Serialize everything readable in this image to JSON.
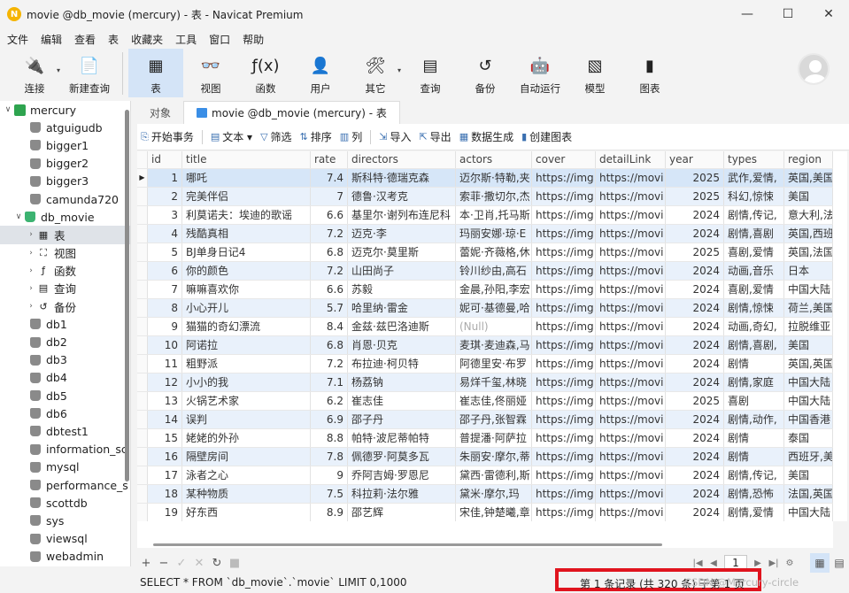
{
  "window": {
    "title": "movie @db_movie (mercury) - 表 - Navicat Premium",
    "minimize": "—",
    "maximize": "☐",
    "close": "✕"
  },
  "menu": [
    "文件",
    "编辑",
    "查看",
    "表",
    "收藏夹",
    "工具",
    "窗口",
    "帮助"
  ],
  "toolbar": [
    {
      "label": "连接",
      "icon": "plug-icon",
      "glyph": "🔌",
      "arrow": true
    },
    {
      "label": "新建查询",
      "icon": "new-query-icon",
      "glyph": "📄"
    },
    {
      "label": "表",
      "icon": "table-icon",
      "glyph": "▦",
      "active": true
    },
    {
      "label": "视图",
      "icon": "view-icon",
      "glyph": "👓"
    },
    {
      "label": "函数",
      "icon": "function-icon",
      "glyph": "ƒ(x)"
    },
    {
      "label": "用户",
      "icon": "user-icon",
      "glyph": "👤"
    },
    {
      "label": "其它",
      "icon": "tools-icon",
      "glyph": "🛠",
      "arrow": true
    },
    {
      "label": "查询",
      "icon": "query-icon",
      "glyph": "▤"
    },
    {
      "label": "备份",
      "icon": "backup-icon",
      "glyph": "↺"
    },
    {
      "label": "自动运行",
      "icon": "robot-icon",
      "glyph": "🤖"
    },
    {
      "label": "模型",
      "icon": "model-icon",
      "glyph": "▧"
    },
    {
      "label": "图表",
      "icon": "chart-icon",
      "glyph": "▮"
    }
  ],
  "tree": {
    "connection": "mercury",
    "databases_before": [
      "atguigudb",
      "bigger1",
      "bigger2",
      "bigger3",
      "camunda720"
    ],
    "open_db": "db_movie",
    "open_db_children": [
      {
        "label": "表",
        "icon": "table-icon",
        "glyph": "▦",
        "selected": true
      },
      {
        "label": "视图",
        "icon": "view-icon",
        "glyph": "⛶"
      },
      {
        "label": "函数",
        "icon": "function-icon",
        "glyph": "ƒ"
      },
      {
        "label": "查询",
        "icon": "query-icon",
        "glyph": "▤"
      },
      {
        "label": "备份",
        "icon": "backup-icon",
        "glyph": "↺"
      }
    ],
    "databases_after": [
      "db1",
      "db2",
      "db3",
      "db4",
      "db5",
      "db6",
      "dbtest1",
      "information_sc",
      "mysql",
      "performance_s",
      "scottdb",
      "sys",
      "viewsql",
      "webadmin"
    ]
  },
  "tabs": [
    {
      "label": "对象",
      "active": false
    },
    {
      "label": "movie @db_movie (mercury) - 表",
      "active": true
    }
  ],
  "actions": [
    {
      "label": "开始事务",
      "icon": "transaction-icon",
      "glyph": "⎘"
    },
    {
      "sep": true
    },
    {
      "label": "文本 ▾",
      "icon": "text-icon",
      "glyph": "▤"
    },
    {
      "label": "筛选",
      "icon": "filter-icon",
      "glyph": "▽"
    },
    {
      "label": "排序",
      "icon": "sort-icon",
      "glyph": "⇅"
    },
    {
      "label": "列",
      "icon": "columns-icon",
      "glyph": "▥"
    },
    {
      "sep": true
    },
    {
      "label": "导入",
      "icon": "import-icon",
      "glyph": "⇲"
    },
    {
      "label": "导出",
      "icon": "export-icon",
      "glyph": "⇱"
    },
    {
      "label": "数据生成",
      "icon": "datagen-icon",
      "glyph": "▦"
    },
    {
      "label": "创建图表",
      "icon": "create-chart-icon",
      "glyph": "▮"
    }
  ],
  "grid": {
    "columns": [
      {
        "name": "id",
        "w": 39
      },
      {
        "name": "title",
        "w": 145
      },
      {
        "name": "rate",
        "w": 42
      },
      {
        "name": "directors",
        "w": 122
      },
      {
        "name": "actors",
        "w": 86
      },
      {
        "name": "cover",
        "w": 72
      },
      {
        "name": "detailLink",
        "w": 79
      },
      {
        "name": "year",
        "w": 66
      },
      {
        "name": "types",
        "w": 68
      },
      {
        "name": "region",
        "w": 55
      }
    ],
    "rows": [
      [
        "1",
        "哪吒",
        "7.4",
        "斯科特·德瑞克森",
        "迈尔斯·特勒,夹",
        "https://img",
        "https://movi",
        "2025",
        "武作,爱情,",
        "英国,美国"
      ],
      [
        "2",
        "完美伴侣",
        "7",
        "德鲁·汉考克",
        "索菲·撒切尔,杰",
        "https://img",
        "https://movi",
        "2025",
        "科幻,惊悚",
        "美国"
      ],
      [
        "3",
        "利莫诺夫：埃迪的歌谣",
        "6.6",
        "基里尔·谢列布连尼科",
        "本·卫肖,托马斯",
        "https://img",
        "https://movi",
        "2024",
        "剧情,传记,",
        "意大利,法"
      ],
      [
        "4",
        "残酷真相",
        "7.2",
        "迈克·李",
        "玛丽安娜·琼·E",
        "https://img",
        "https://movi",
        "2024",
        "剧情,喜剧",
        "英国,西班"
      ],
      [
        "5",
        "BJ单身日记4",
        "6.8",
        "迈克尔·莫里斯",
        "蕾妮·齐薇格,休",
        "https://img",
        "https://movi",
        "2025",
        "喜剧,爱情",
        "英国,法国"
      ],
      [
        "6",
        "你的颜色",
        "7.2",
        "山田尚子",
        "铃川纱由,高石",
        "https://img",
        "https://movi",
        "2024",
        "动画,音乐",
        "日本"
      ],
      [
        "7",
        "嘛嘛喜欢你",
        "6.6",
        "苏毅",
        "金晨,孙阳,李宏",
        "https://img",
        "https://movi",
        "2024",
        "喜剧,爱情",
        "中国大陆"
      ],
      [
        "8",
        "小心开儿",
        "5.7",
        "哈里纳·雷金",
        "妮可·基德曼,哈",
        "https://img",
        "https://movi",
        "2024",
        "剧情,惊悚",
        "荷兰,美国"
      ],
      [
        "9",
        "猫猫的奇幻漂流",
        "8.4",
        "金兹·兹巴洛迪斯",
        "(Null)",
        "https://img",
        "https://movi",
        "2024",
        "动画,奇幻,",
        "拉脱维亚"
      ],
      [
        "10",
        "阿诺拉",
        "6.8",
        "肖恩·贝克",
        "麦琪·麦迪森,马",
        "https://img",
        "https://movi",
        "2024",
        "剧情,喜剧,",
        "美国"
      ],
      [
        "11",
        "粗野派",
        "7.2",
        "布拉迪·柯贝特",
        "阿德里安·布罗",
        "https://img",
        "https://movi",
        "2024",
        "剧情",
        "英国,英国"
      ],
      [
        "12",
        "小小的我",
        "7.1",
        "杨荔钠",
        "易烊千玺,林晓",
        "https://img",
        "https://movi",
        "2024",
        "剧情,家庭",
        "中国大陆"
      ],
      [
        "13",
        "火锅艺术家",
        "6.2",
        "崔志佳",
        "崔志佳,佟丽娅",
        "https://img",
        "https://movi",
        "2025",
        "喜剧",
        "中国大陆"
      ],
      [
        "14",
        "误判",
        "6.9",
        "邵子丹",
        "邵子丹,张智霖",
        "https://img",
        "https://movi",
        "2024",
        "剧情,动作,",
        "中国香港"
      ],
      [
        "15",
        "姥姥的外孙",
        "8.8",
        "帕特·波尼蒂帕特",
        "普提潘·阿萨拉",
        "https://img",
        "https://movi",
        "2024",
        "剧情",
        "泰国"
      ],
      [
        "16",
        "隔壁房间",
        "7.8",
        "佩德罗·阿莫多瓦",
        "朱丽安·摩尔,蒂",
        "https://img",
        "https://movi",
        "2024",
        "剧情",
        "西班牙,美"
      ],
      [
        "17",
        "泳者之心",
        "9",
        "乔阿吉姆·罗恩尼",
        "黛西·雷德利,斯",
        "https://img",
        "https://movi",
        "2024",
        "剧情,传记,",
        "美国"
      ],
      [
        "18",
        "某种物质",
        "7.5",
        "科拉莉·法尔雅",
        "黛米·摩尔,玛",
        "https://img",
        "https://movi",
        "2024",
        "剧情,恐怖",
        "法国,英国"
      ],
      [
        "19",
        "好东西",
        "8.9",
        "邵艺辉",
        "宋佳,钟楚曦,章",
        "https://img",
        "https://movi",
        "2024",
        "剧情,爱情",
        "中国大陆"
      ]
    ]
  },
  "nav": {
    "add": "+",
    "remove": "−",
    "apply": "✓",
    "cancel": "✕",
    "refresh": "↻",
    "stop": "■",
    "first": "|◀",
    "prev": "◀",
    "page": "1",
    "next": "▶",
    "last": "▶|",
    "settings": "⚙",
    "grid_view": "▦",
    "form_view": "▤"
  },
  "status": {
    "sql": "SELECT * FROM `db_movie`.`movie` LIMIT 0,1000",
    "record": "第 1 条记录 (共 320 条) 于第 1 页",
    "watermark": "CSDN @Mercury-circle",
    "highlight_color": "#e0141e"
  }
}
